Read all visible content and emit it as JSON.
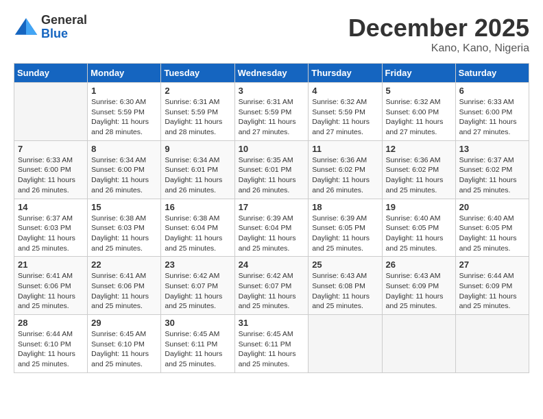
{
  "logo": {
    "general": "General",
    "blue": "Blue"
  },
  "title": "December 2025",
  "location": "Kano, Kano, Nigeria",
  "days_of_week": [
    "Sunday",
    "Monday",
    "Tuesday",
    "Wednesday",
    "Thursday",
    "Friday",
    "Saturday"
  ],
  "weeks": [
    [
      {
        "day": "",
        "sunrise": "",
        "sunset": "",
        "daylight": ""
      },
      {
        "day": "1",
        "sunrise": "Sunrise: 6:30 AM",
        "sunset": "Sunset: 5:59 PM",
        "daylight": "Daylight: 11 hours and 28 minutes."
      },
      {
        "day": "2",
        "sunrise": "Sunrise: 6:31 AM",
        "sunset": "Sunset: 5:59 PM",
        "daylight": "Daylight: 11 hours and 28 minutes."
      },
      {
        "day": "3",
        "sunrise": "Sunrise: 6:31 AM",
        "sunset": "Sunset: 5:59 PM",
        "daylight": "Daylight: 11 hours and 27 minutes."
      },
      {
        "day": "4",
        "sunrise": "Sunrise: 6:32 AM",
        "sunset": "Sunset: 5:59 PM",
        "daylight": "Daylight: 11 hours and 27 minutes."
      },
      {
        "day": "5",
        "sunrise": "Sunrise: 6:32 AM",
        "sunset": "Sunset: 6:00 PM",
        "daylight": "Daylight: 11 hours and 27 minutes."
      },
      {
        "day": "6",
        "sunrise": "Sunrise: 6:33 AM",
        "sunset": "Sunset: 6:00 PM",
        "daylight": "Daylight: 11 hours and 27 minutes."
      }
    ],
    [
      {
        "day": "7",
        "sunrise": "Sunrise: 6:33 AM",
        "sunset": "Sunset: 6:00 PM",
        "daylight": "Daylight: 11 hours and 26 minutes."
      },
      {
        "day": "8",
        "sunrise": "Sunrise: 6:34 AM",
        "sunset": "Sunset: 6:00 PM",
        "daylight": "Daylight: 11 hours and 26 minutes."
      },
      {
        "day": "9",
        "sunrise": "Sunrise: 6:34 AM",
        "sunset": "Sunset: 6:01 PM",
        "daylight": "Daylight: 11 hours and 26 minutes."
      },
      {
        "day": "10",
        "sunrise": "Sunrise: 6:35 AM",
        "sunset": "Sunset: 6:01 PM",
        "daylight": "Daylight: 11 hours and 26 minutes."
      },
      {
        "day": "11",
        "sunrise": "Sunrise: 6:36 AM",
        "sunset": "Sunset: 6:02 PM",
        "daylight": "Daylight: 11 hours and 26 minutes."
      },
      {
        "day": "12",
        "sunrise": "Sunrise: 6:36 AM",
        "sunset": "Sunset: 6:02 PM",
        "daylight": "Daylight: 11 hours and 25 minutes."
      },
      {
        "day": "13",
        "sunrise": "Sunrise: 6:37 AM",
        "sunset": "Sunset: 6:02 PM",
        "daylight": "Daylight: 11 hours and 25 minutes."
      }
    ],
    [
      {
        "day": "14",
        "sunrise": "Sunrise: 6:37 AM",
        "sunset": "Sunset: 6:03 PM",
        "daylight": "Daylight: 11 hours and 25 minutes."
      },
      {
        "day": "15",
        "sunrise": "Sunrise: 6:38 AM",
        "sunset": "Sunset: 6:03 PM",
        "daylight": "Daylight: 11 hours and 25 minutes."
      },
      {
        "day": "16",
        "sunrise": "Sunrise: 6:38 AM",
        "sunset": "Sunset: 6:04 PM",
        "daylight": "Daylight: 11 hours and 25 minutes."
      },
      {
        "day": "17",
        "sunrise": "Sunrise: 6:39 AM",
        "sunset": "Sunset: 6:04 PM",
        "daylight": "Daylight: 11 hours and 25 minutes."
      },
      {
        "day": "18",
        "sunrise": "Sunrise: 6:39 AM",
        "sunset": "Sunset: 6:05 PM",
        "daylight": "Daylight: 11 hours and 25 minutes."
      },
      {
        "day": "19",
        "sunrise": "Sunrise: 6:40 AM",
        "sunset": "Sunset: 6:05 PM",
        "daylight": "Daylight: 11 hours and 25 minutes."
      },
      {
        "day": "20",
        "sunrise": "Sunrise: 6:40 AM",
        "sunset": "Sunset: 6:05 PM",
        "daylight": "Daylight: 11 hours and 25 minutes."
      }
    ],
    [
      {
        "day": "21",
        "sunrise": "Sunrise: 6:41 AM",
        "sunset": "Sunset: 6:06 PM",
        "daylight": "Daylight: 11 hours and 25 minutes."
      },
      {
        "day": "22",
        "sunrise": "Sunrise: 6:41 AM",
        "sunset": "Sunset: 6:06 PM",
        "daylight": "Daylight: 11 hours and 25 minutes."
      },
      {
        "day": "23",
        "sunrise": "Sunrise: 6:42 AM",
        "sunset": "Sunset: 6:07 PM",
        "daylight": "Daylight: 11 hours and 25 minutes."
      },
      {
        "day": "24",
        "sunrise": "Sunrise: 6:42 AM",
        "sunset": "Sunset: 6:07 PM",
        "daylight": "Daylight: 11 hours and 25 minutes."
      },
      {
        "day": "25",
        "sunrise": "Sunrise: 6:43 AM",
        "sunset": "Sunset: 6:08 PM",
        "daylight": "Daylight: 11 hours and 25 minutes."
      },
      {
        "day": "26",
        "sunrise": "Sunrise: 6:43 AM",
        "sunset": "Sunset: 6:09 PM",
        "daylight": "Daylight: 11 hours and 25 minutes."
      },
      {
        "day": "27",
        "sunrise": "Sunrise: 6:44 AM",
        "sunset": "Sunset: 6:09 PM",
        "daylight": "Daylight: 11 hours and 25 minutes."
      }
    ],
    [
      {
        "day": "28",
        "sunrise": "Sunrise: 6:44 AM",
        "sunset": "Sunset: 6:10 PM",
        "daylight": "Daylight: 11 hours and 25 minutes."
      },
      {
        "day": "29",
        "sunrise": "Sunrise: 6:45 AM",
        "sunset": "Sunset: 6:10 PM",
        "daylight": "Daylight: 11 hours and 25 minutes."
      },
      {
        "day": "30",
        "sunrise": "Sunrise: 6:45 AM",
        "sunset": "Sunset: 6:11 PM",
        "daylight": "Daylight: 11 hours and 25 minutes."
      },
      {
        "day": "31",
        "sunrise": "Sunrise: 6:45 AM",
        "sunset": "Sunset: 6:11 PM",
        "daylight": "Daylight: 11 hours and 25 minutes."
      },
      {
        "day": "",
        "sunrise": "",
        "sunset": "",
        "daylight": ""
      },
      {
        "day": "",
        "sunrise": "",
        "sunset": "",
        "daylight": ""
      },
      {
        "day": "",
        "sunrise": "",
        "sunset": "",
        "daylight": ""
      }
    ]
  ]
}
